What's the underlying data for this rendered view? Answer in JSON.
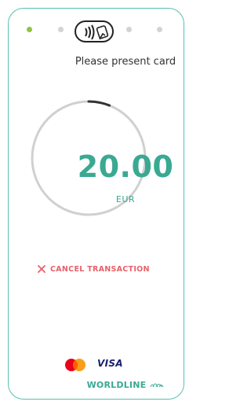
{
  "screen": {
    "prompt": "Please present card",
    "amount": "20.00",
    "currency": "EUR",
    "cancel_label": "CANCEL TRANSACTION"
  },
  "steps": {
    "count": 5,
    "active_index": 0,
    "center_icon": "contactless-tap-icon"
  },
  "progress_ring": {
    "fraction": 0.06
  },
  "footer": {
    "card_brands": [
      "mastercard-logo",
      "VISA"
    ],
    "brand_visa": "VISA",
    "provider_bold": "WORLDLINE",
    "provider_icon": "worldline-waves-icon"
  },
  "colors": {
    "accent": "#3aa992",
    "border": "#58c0ad",
    "step_active": "#8cc63f",
    "step_inactive": "#d3d3d3",
    "cancel": "#e8616b",
    "ring_track": "#d0d0d0",
    "ring_progress": "#333333"
  }
}
